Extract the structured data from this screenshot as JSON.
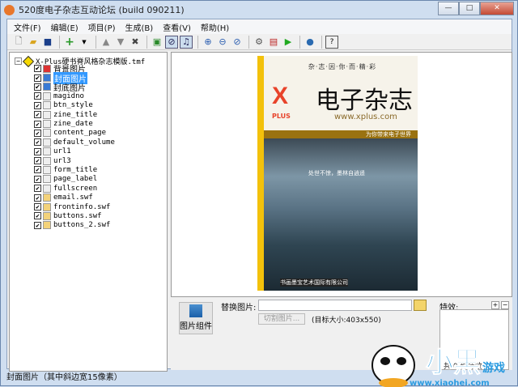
{
  "window": {
    "title": "520度电子杂志互动论坛 (build 090211)",
    "controls": [
      "—",
      "□",
      "✕"
    ]
  },
  "menu": [
    "文件(F)",
    "编辑(E)",
    "项目(P)",
    "生成(B)",
    "查看(V)",
    "帮助(H)"
  ],
  "toolbar": [
    "new-file",
    "open-folder",
    "save",
    "add",
    "dropdown",
    "move-up",
    "move-down",
    "delete",
    "import-image",
    "edit-mode",
    "music-mode",
    "zoom-in",
    "zoom-out",
    "zoom-fit",
    "settings",
    "preview-generate",
    "play",
    "web",
    "help"
  ],
  "tree": {
    "root": "X-Plus硬书脊风格杂志模版.tmf",
    "items": [
      {
        "label": "背景图片",
        "type": "bg",
        "checked": true
      },
      {
        "label": "封面图片",
        "type": "png",
        "checked": true,
        "selected": true
      },
      {
        "label": "封底图片",
        "type": "png",
        "checked": true
      },
      {
        "label": "magidno",
        "type": "txt",
        "checked": true
      },
      {
        "label": "btn_style",
        "type": "txt",
        "checked": true
      },
      {
        "label": "zine_title",
        "type": "txt",
        "checked": true
      },
      {
        "label": "zine_date",
        "type": "txt",
        "checked": true
      },
      {
        "label": "content_page",
        "type": "txt",
        "checked": true
      },
      {
        "label": "default_volume",
        "type": "txt",
        "checked": true
      },
      {
        "label": "url1",
        "type": "txt",
        "checked": true
      },
      {
        "label": "url3",
        "type": "txt",
        "checked": true
      },
      {
        "label": "form_title",
        "type": "txt",
        "checked": true
      },
      {
        "label": "page_label",
        "type": "txt",
        "checked": true
      },
      {
        "label": "fullscreen",
        "type": "txt",
        "checked": true
      },
      {
        "label": "email.swf",
        "type": "swf",
        "checked": true
      },
      {
        "label": "frontinfo.swf",
        "type": "swf",
        "checked": true
      },
      {
        "label": "buttons.swf",
        "type": "swf",
        "checked": true
      },
      {
        "label": "buttons_2.swf",
        "type": "swf",
        "checked": true
      }
    ]
  },
  "cover": {
    "slogan": "杂·志·因·你·而·精·彩",
    "logo": "X",
    "logo_sub": "PLUS",
    "title": "电子杂志",
    "url": "www.xplus.com",
    "band": "为你带来电子世界",
    "caption": "处世不惊，墨林自逍遥",
    "footer": "书画墨宝艺术国际有限公司"
  },
  "props": {
    "component_label": "图片组件",
    "replace_label": "替换图片:",
    "replace_value": "",
    "cut_button": "切割图片...",
    "target_size": "(目标大小:403x550)",
    "effects_label": "特效:",
    "add": "+",
    "remove": "−",
    "effects_count": "共 0 种特效"
  },
  "status": "封面图片（其中斜边宽15像素）",
  "watermark": {
    "text": "小黑游戏",
    "url": "www.xiaohei.com"
  }
}
